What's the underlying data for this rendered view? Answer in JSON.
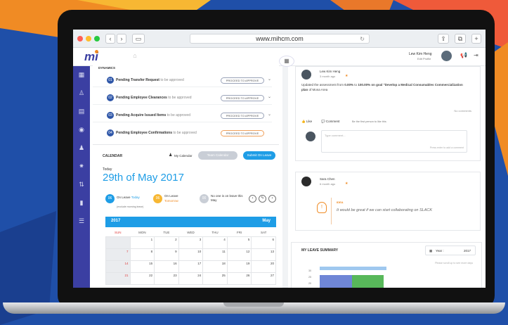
{
  "browser": {
    "url": "www.mihcm.com"
  },
  "header": {
    "logo": "mi",
    "user_name": "Lew Kim Heng",
    "user_role": "Edit Profile"
  },
  "dynamics": {
    "title": "DYNAMICS",
    "items": [
      {
        "num": "01",
        "label": "Pending Transfer Request",
        "suffix": "to be approved",
        "action": "PROCEED TO APPROVE"
      },
      {
        "num": "02",
        "label": "Pending Employee Clearances",
        "suffix": "to be approved",
        "action": "PROCEED TO APPROVE"
      },
      {
        "num": "03",
        "label": "Pending Acquire Issued Items",
        "suffix": "to be approved",
        "action": "PROCEED TO APPROVE"
      },
      {
        "num": "04",
        "label": "Pending Employee Confirmations",
        "suffix": "to be approved",
        "action": "PROCEED TO APPROVE"
      }
    ]
  },
  "calendar": {
    "title": "CALENDAR",
    "my_calendar": "My Calendar",
    "team_calendar": "Team Calendar",
    "submit": "Submit On Leave",
    "today_label": "Today",
    "date": "29th of May 2017",
    "on_leave_today": {
      "count": "06",
      "title": "On Leave",
      "highlight": "Today",
      "note": "(exclude morning leave)"
    },
    "on_leave_tomorrow": {
      "count": "06",
      "title": "On Leave",
      "highlight": "Tomorrow"
    },
    "no_leave": {
      "count": "00",
      "text": "No one is on leave this May"
    },
    "year": "2017",
    "month": "May",
    "weekdays": [
      "SUN",
      "MON",
      "TUE",
      "WED",
      "THU",
      "FRI",
      "SAT"
    ],
    "weeks": [
      [
        "",
        "1",
        "2",
        "3",
        "4",
        "5",
        "6"
      ],
      [
        "7",
        "8",
        "9",
        "10",
        "11",
        "12",
        "13"
      ],
      [
        "14",
        "15",
        "16",
        "17",
        "18",
        "19",
        "20"
      ],
      [
        "21",
        "22",
        "23",
        "24",
        "25",
        "26",
        "27"
      ]
    ]
  },
  "feed": {
    "post1": {
      "author": "Lew Kim Heng",
      "time": "3 month ago",
      "text1": "Updated the assessment from ",
      "pct_from": "0.00%",
      "text2": " to ",
      "pct_to": "100.00%",
      "text3": " on goal \"Develop a Medical Consumables Commercialization plan",
      "text4": " of Mona Area",
      "comments_count": "No comments",
      "like": "Like",
      "comment": "Comment",
      "be_first": "Be the first person to like this",
      "placeholder": "Type comment...",
      "enter_hint": "Press enter to add a comment"
    },
    "post2": {
      "author": "Sara Chen",
      "time": "6 month ago",
      "idea_label": "IDEA",
      "text": "It would be great if we can start collaborating on SLACK"
    }
  },
  "leave_summary": {
    "title": "MY LEAVE SUMMARY",
    "year_label": "Year :",
    "year": "2017",
    "hint": "Please scroll up to see more days",
    "y_ticks": [
      "30",
      "25",
      "20"
    ]
  }
}
